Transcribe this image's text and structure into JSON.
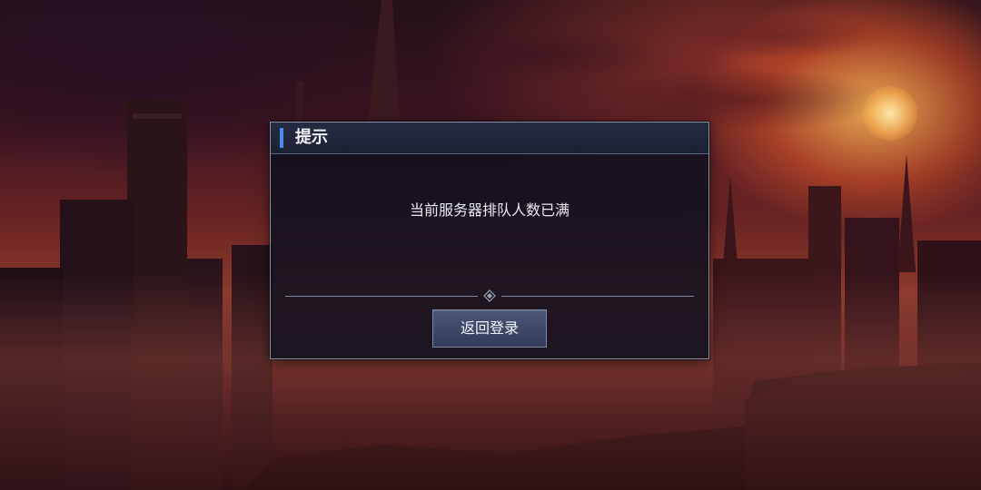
{
  "dialog": {
    "title": "提示",
    "message": "当前服务器排队人数已满",
    "confirm_label": "返回登录"
  },
  "colors": {
    "accent": "#4a8ee8",
    "dialog_bg": "#0e101e",
    "button_bg": "#3f4868"
  },
  "icons": {
    "divider": "diamond-ornament-icon"
  }
}
